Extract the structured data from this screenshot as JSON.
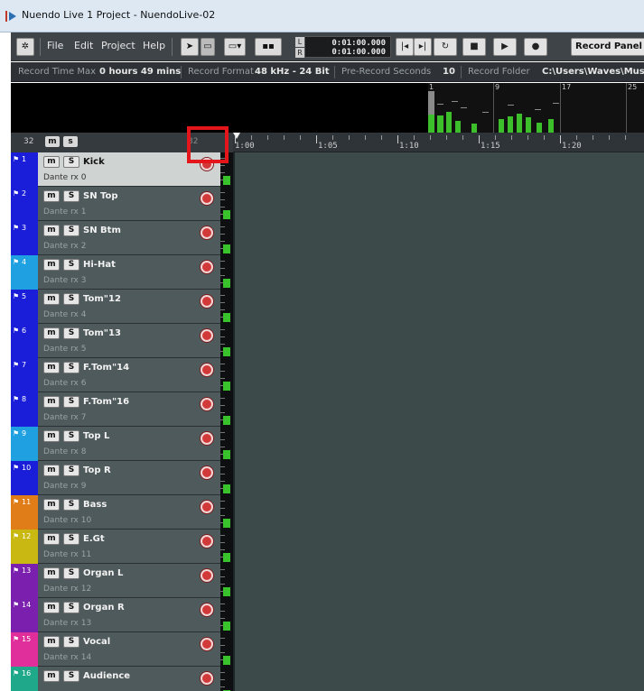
{
  "window": {
    "title": "Nuendo Live 1 Project - NuendoLive-02"
  },
  "toolbar": {
    "menus": [
      "File",
      "Edit",
      "Project",
      "Help"
    ],
    "timecode_left": "0:01:00.000",
    "timecode_right": "0:01:00.000",
    "left_marker": "L",
    "right_marker": "R",
    "record_panel_label": "Record Panel"
  },
  "infobar": {
    "record_time_max_label": "Record Time Max",
    "record_time_max_value": "0 hours 49 mins",
    "record_format_label": "Record Format",
    "record_format_value": "48 kHz - 24 Bit",
    "pre_record_label": "Pre-Record Seconds",
    "pre_record_value": "10",
    "record_folder_label": "Record Folder",
    "record_folder_value": "C:\\Users\\Waves\\Music\\"
  },
  "overview": {
    "markers": [
      "1",
      "9",
      "17",
      "25"
    ]
  },
  "track_header": {
    "count": "32",
    "m_label": "m",
    "s_label": "s",
    "hdr_num": "32"
  },
  "ruler": {
    "labels": [
      "1:00",
      "1:05",
      "1:10",
      "1:15",
      "1:20"
    ]
  },
  "tracks": [
    {
      "num": "1",
      "name": "Kick",
      "input": "Dante rx 0",
      "color": "#1a1ed8",
      "selected": true,
      "meter": 0.3
    },
    {
      "num": "2",
      "name": "SN Top",
      "input": "Dante rx 1",
      "color": "#1a1ed8",
      "selected": false,
      "meter": 0.3
    },
    {
      "num": "3",
      "name": "SN Btm",
      "input": "Dante rx 2",
      "color": "#1a1ed8",
      "selected": false,
      "meter": 0.3
    },
    {
      "num": "4",
      "name": "Hi-Hat",
      "input": "Dante rx 3",
      "color": "#1fa0e0",
      "selected": false,
      "meter": 0.3
    },
    {
      "num": "5",
      "name": "Tom\"12",
      "input": "Dante rx 4",
      "color": "#1a1ed8",
      "selected": false,
      "meter": 0.3
    },
    {
      "num": "6",
      "name": "Tom\"13",
      "input": "Dante rx 5",
      "color": "#1a1ed8",
      "selected": false,
      "meter": 0.3
    },
    {
      "num": "7",
      "name": "F.Tom\"14",
      "input": "Dante rx 6",
      "color": "#1a1ed8",
      "selected": false,
      "meter": 0.3
    },
    {
      "num": "8",
      "name": "F.Tom\"16",
      "input": "Dante rx 7",
      "color": "#1a1ed8",
      "selected": false,
      "meter": 0.3
    },
    {
      "num": "9",
      "name": "Top L",
      "input": "Dante rx 8",
      "color": "#1fa0e0",
      "selected": false,
      "meter": 0.3
    },
    {
      "num": "10",
      "name": "Top R",
      "input": "Dante rx 9",
      "color": "#1a1ed8",
      "selected": false,
      "meter": 0.3
    },
    {
      "num": "11",
      "name": "Bass",
      "input": "Dante rx 10",
      "color": "#e07d18",
      "selected": false,
      "meter": 0.3
    },
    {
      "num": "12",
      "name": "E.Gt",
      "input": "Dante rx 11",
      "color": "#c9b812",
      "selected": false,
      "meter": 0.3
    },
    {
      "num": "13",
      "name": "Organ L",
      "input": "Dante rx 12",
      "color": "#7a1fae",
      "selected": false,
      "meter": 0.3
    },
    {
      "num": "14",
      "name": "Organ R",
      "input": "Dante rx 13",
      "color": "#7a1fae",
      "selected": false,
      "meter": 0.3
    },
    {
      "num": "15",
      "name": "Vocal",
      "input": "Dante rx 14",
      "color": "#e02f9a",
      "selected": false,
      "meter": 0.3
    },
    {
      "num": "16",
      "name": "Audience",
      "input": "",
      "color": "#1fa88a",
      "selected": false,
      "meter": 0.3
    }
  ],
  "button_labels": {
    "mute": "m",
    "solo": "S"
  }
}
